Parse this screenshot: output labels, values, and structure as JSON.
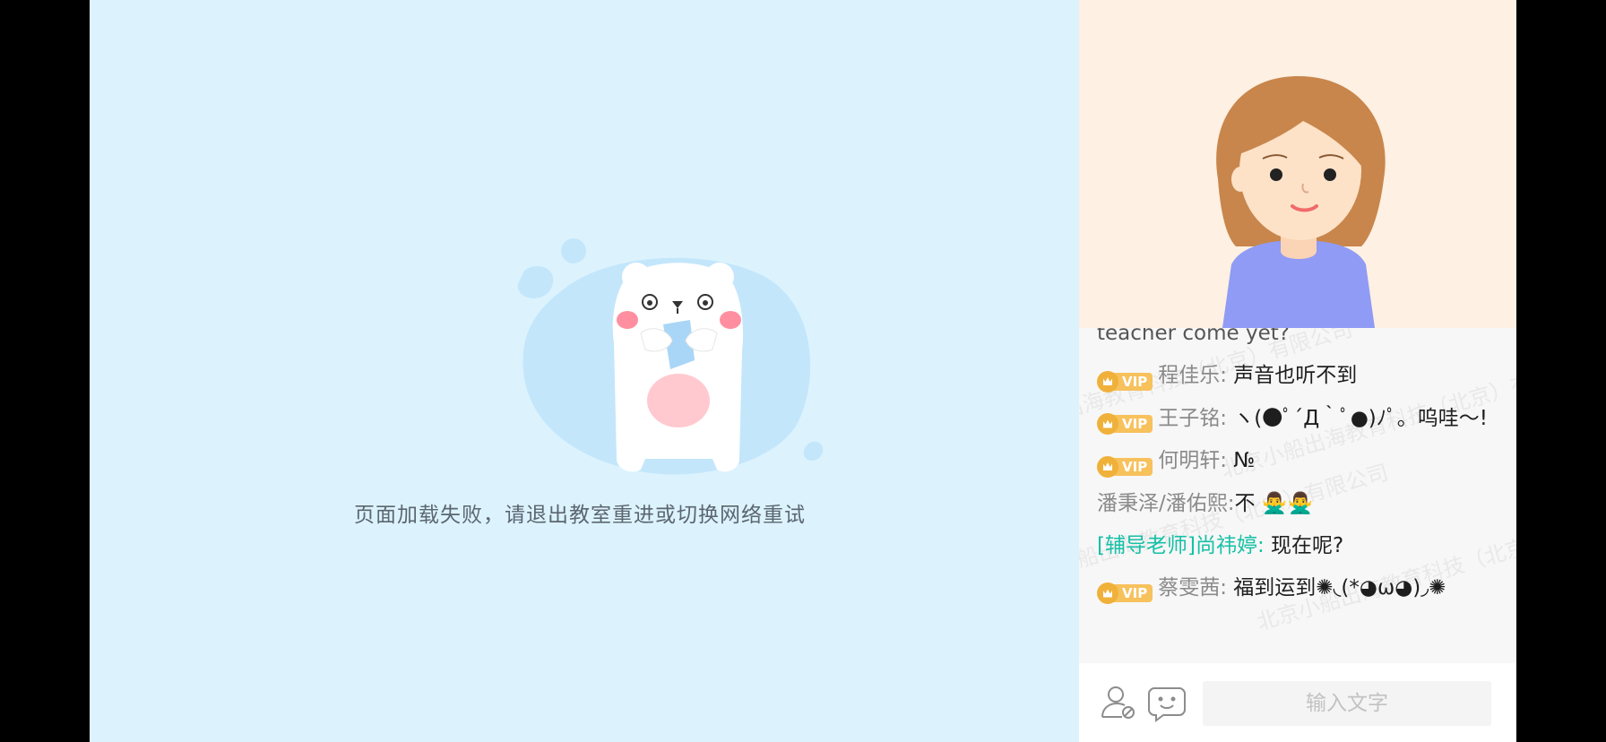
{
  "error": {
    "message": "页面加载失败，请退出教室重进或切换网络重试"
  },
  "chat": {
    "watermark": "北京小船出海教育科技（北京）有限公司",
    "partial_message": "teacher come yet?",
    "messages": [
      {
        "vip": true,
        "vip_label": "VIP",
        "name": "程佳乐:",
        "text": "声音也听不到",
        "role": "student"
      },
      {
        "vip": true,
        "vip_label": "VIP",
        "name": "王子铭:",
        "text": "ヽ(●ﾟ´Д｀ﾟ●)ﾉﾟ。呜哇～!",
        "role": "student"
      },
      {
        "vip": true,
        "vip_label": "VIP",
        "name": "何明轩:",
        "text": "№",
        "role": "student"
      },
      {
        "vip": false,
        "vip_label": "",
        "name": "潘秉泽/潘佑熙:",
        "text": "不 🙅‍♂️🙅‍♂️",
        "role": "student"
      },
      {
        "vip": false,
        "vip_label": "",
        "name": "[辅导老师]尚祎婷:",
        "text": "现在呢?",
        "role": "teacher"
      },
      {
        "vip": true,
        "vip_label": "VIP",
        "name": "蔡雯茜:",
        "text": "福到运到✺◟(*◕ω◕)◞✺",
        "role": "student"
      }
    ]
  },
  "input": {
    "placeholder": "输入文字"
  },
  "icons": {
    "user_icon": "user-mute-icon",
    "emoji_icon": "emoji-icon"
  },
  "colors": {
    "stage_bg": "#dcf3fe",
    "video_bg": "#fef0e2",
    "teacher_name": "#16c0a6",
    "vip_gold": "#f0b13a"
  }
}
